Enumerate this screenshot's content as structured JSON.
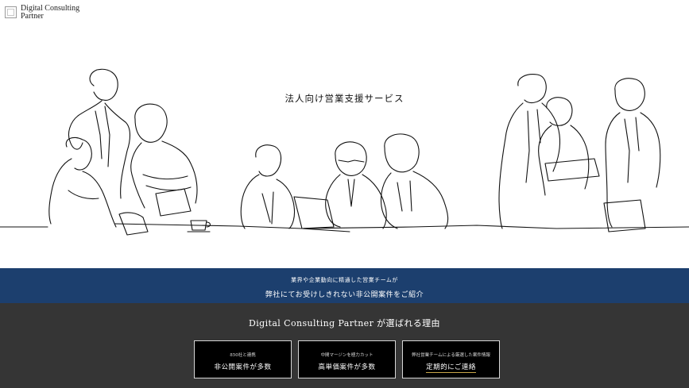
{
  "header": {
    "logo_line1": "Digital Consulting",
    "logo_line2": "Partner"
  },
  "hero": {
    "title": "法人向け営業支援サービス",
    "image_icon": "line-drawing-business-people-icon"
  },
  "band": {
    "line1": "業界や企業動向に精通した営業チームが",
    "line2": "弊社にてお受けしきれない非公開案件をご紹介"
  },
  "reasons": {
    "title": "Digital Consulting Partner が選ばれる理由",
    "cards": [
      {
        "sub": "850社と連携",
        "main": "非公開案件が多数"
      },
      {
        "sub": "中間マージンを極力カット",
        "main": "高単価案件が多数"
      },
      {
        "sub": "弊社営業チームによる厳選した案件情報",
        "main": "定期的にご連絡"
      }
    ]
  },
  "colors": {
    "band_blue": "#1c3f6e",
    "dark_section": "#353535",
    "card_bg": "#000000",
    "accent_gold": "#c9a74a"
  }
}
